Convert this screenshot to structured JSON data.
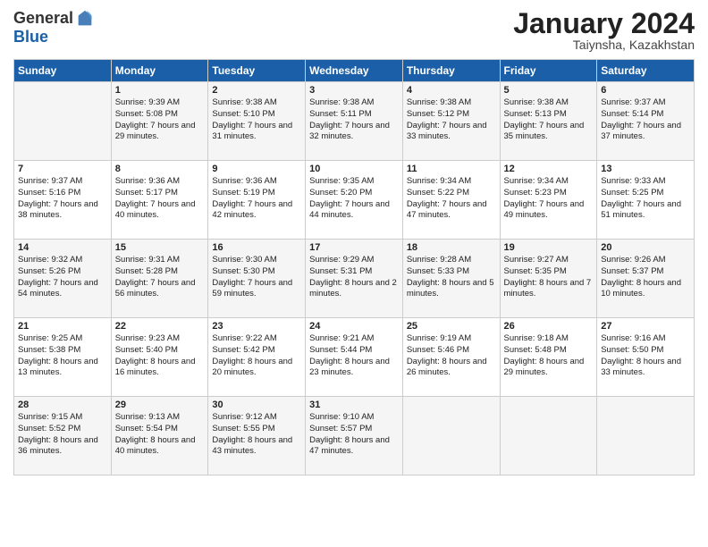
{
  "logo": {
    "general": "General",
    "blue": "Blue"
  },
  "title": "January 2024",
  "location": "Taiynsha, Kazakhstan",
  "days_header": [
    "Sunday",
    "Monday",
    "Tuesday",
    "Wednesday",
    "Thursday",
    "Friday",
    "Saturday"
  ],
  "weeks": [
    [
      {
        "day": "",
        "sunrise": "",
        "sunset": "",
        "daylight": ""
      },
      {
        "day": "1",
        "sunrise": "Sunrise: 9:39 AM",
        "sunset": "Sunset: 5:08 PM",
        "daylight": "Daylight: 7 hours and 29 minutes."
      },
      {
        "day": "2",
        "sunrise": "Sunrise: 9:38 AM",
        "sunset": "Sunset: 5:10 PM",
        "daylight": "Daylight: 7 hours and 31 minutes."
      },
      {
        "day": "3",
        "sunrise": "Sunrise: 9:38 AM",
        "sunset": "Sunset: 5:11 PM",
        "daylight": "Daylight: 7 hours and 32 minutes."
      },
      {
        "day": "4",
        "sunrise": "Sunrise: 9:38 AM",
        "sunset": "Sunset: 5:12 PM",
        "daylight": "Daylight: 7 hours and 33 minutes."
      },
      {
        "day": "5",
        "sunrise": "Sunrise: 9:38 AM",
        "sunset": "Sunset: 5:13 PM",
        "daylight": "Daylight: 7 hours and 35 minutes."
      },
      {
        "day": "6",
        "sunrise": "Sunrise: 9:37 AM",
        "sunset": "Sunset: 5:14 PM",
        "daylight": "Daylight: 7 hours and 37 minutes."
      }
    ],
    [
      {
        "day": "7",
        "sunrise": "Sunrise: 9:37 AM",
        "sunset": "Sunset: 5:16 PM",
        "daylight": "Daylight: 7 hours and 38 minutes."
      },
      {
        "day": "8",
        "sunrise": "Sunrise: 9:36 AM",
        "sunset": "Sunset: 5:17 PM",
        "daylight": "Daylight: 7 hours and 40 minutes."
      },
      {
        "day": "9",
        "sunrise": "Sunrise: 9:36 AM",
        "sunset": "Sunset: 5:19 PM",
        "daylight": "Daylight: 7 hours and 42 minutes."
      },
      {
        "day": "10",
        "sunrise": "Sunrise: 9:35 AM",
        "sunset": "Sunset: 5:20 PM",
        "daylight": "Daylight: 7 hours and 44 minutes."
      },
      {
        "day": "11",
        "sunrise": "Sunrise: 9:34 AM",
        "sunset": "Sunset: 5:22 PM",
        "daylight": "Daylight: 7 hours and 47 minutes."
      },
      {
        "day": "12",
        "sunrise": "Sunrise: 9:34 AM",
        "sunset": "Sunset: 5:23 PM",
        "daylight": "Daylight: 7 hours and 49 minutes."
      },
      {
        "day": "13",
        "sunrise": "Sunrise: 9:33 AM",
        "sunset": "Sunset: 5:25 PM",
        "daylight": "Daylight: 7 hours and 51 minutes."
      }
    ],
    [
      {
        "day": "14",
        "sunrise": "Sunrise: 9:32 AM",
        "sunset": "Sunset: 5:26 PM",
        "daylight": "Daylight: 7 hours and 54 minutes."
      },
      {
        "day": "15",
        "sunrise": "Sunrise: 9:31 AM",
        "sunset": "Sunset: 5:28 PM",
        "daylight": "Daylight: 7 hours and 56 minutes."
      },
      {
        "day": "16",
        "sunrise": "Sunrise: 9:30 AM",
        "sunset": "Sunset: 5:30 PM",
        "daylight": "Daylight: 7 hours and 59 minutes."
      },
      {
        "day": "17",
        "sunrise": "Sunrise: 9:29 AM",
        "sunset": "Sunset: 5:31 PM",
        "daylight": "Daylight: 8 hours and 2 minutes."
      },
      {
        "day": "18",
        "sunrise": "Sunrise: 9:28 AM",
        "sunset": "Sunset: 5:33 PM",
        "daylight": "Daylight: 8 hours and 5 minutes."
      },
      {
        "day": "19",
        "sunrise": "Sunrise: 9:27 AM",
        "sunset": "Sunset: 5:35 PM",
        "daylight": "Daylight: 8 hours and 7 minutes."
      },
      {
        "day": "20",
        "sunrise": "Sunrise: 9:26 AM",
        "sunset": "Sunset: 5:37 PM",
        "daylight": "Daylight: 8 hours and 10 minutes."
      }
    ],
    [
      {
        "day": "21",
        "sunrise": "Sunrise: 9:25 AM",
        "sunset": "Sunset: 5:38 PM",
        "daylight": "Daylight: 8 hours and 13 minutes."
      },
      {
        "day": "22",
        "sunrise": "Sunrise: 9:23 AM",
        "sunset": "Sunset: 5:40 PM",
        "daylight": "Daylight: 8 hours and 16 minutes."
      },
      {
        "day": "23",
        "sunrise": "Sunrise: 9:22 AM",
        "sunset": "Sunset: 5:42 PM",
        "daylight": "Daylight: 8 hours and 20 minutes."
      },
      {
        "day": "24",
        "sunrise": "Sunrise: 9:21 AM",
        "sunset": "Sunset: 5:44 PM",
        "daylight": "Daylight: 8 hours and 23 minutes."
      },
      {
        "day": "25",
        "sunrise": "Sunrise: 9:19 AM",
        "sunset": "Sunset: 5:46 PM",
        "daylight": "Daylight: 8 hours and 26 minutes."
      },
      {
        "day": "26",
        "sunrise": "Sunrise: 9:18 AM",
        "sunset": "Sunset: 5:48 PM",
        "daylight": "Daylight: 8 hours and 29 minutes."
      },
      {
        "day": "27",
        "sunrise": "Sunrise: 9:16 AM",
        "sunset": "Sunset: 5:50 PM",
        "daylight": "Daylight: 8 hours and 33 minutes."
      }
    ],
    [
      {
        "day": "28",
        "sunrise": "Sunrise: 9:15 AM",
        "sunset": "Sunset: 5:52 PM",
        "daylight": "Daylight: 8 hours and 36 minutes."
      },
      {
        "day": "29",
        "sunrise": "Sunrise: 9:13 AM",
        "sunset": "Sunset: 5:54 PM",
        "daylight": "Daylight: 8 hours and 40 minutes."
      },
      {
        "day": "30",
        "sunrise": "Sunrise: 9:12 AM",
        "sunset": "Sunset: 5:55 PM",
        "daylight": "Daylight: 8 hours and 43 minutes."
      },
      {
        "day": "31",
        "sunrise": "Sunrise: 9:10 AM",
        "sunset": "Sunset: 5:57 PM",
        "daylight": "Daylight: 8 hours and 47 minutes."
      },
      {
        "day": "",
        "sunrise": "",
        "sunset": "",
        "daylight": ""
      },
      {
        "day": "",
        "sunrise": "",
        "sunset": "",
        "daylight": ""
      },
      {
        "day": "",
        "sunrise": "",
        "sunset": "",
        "daylight": ""
      }
    ]
  ]
}
